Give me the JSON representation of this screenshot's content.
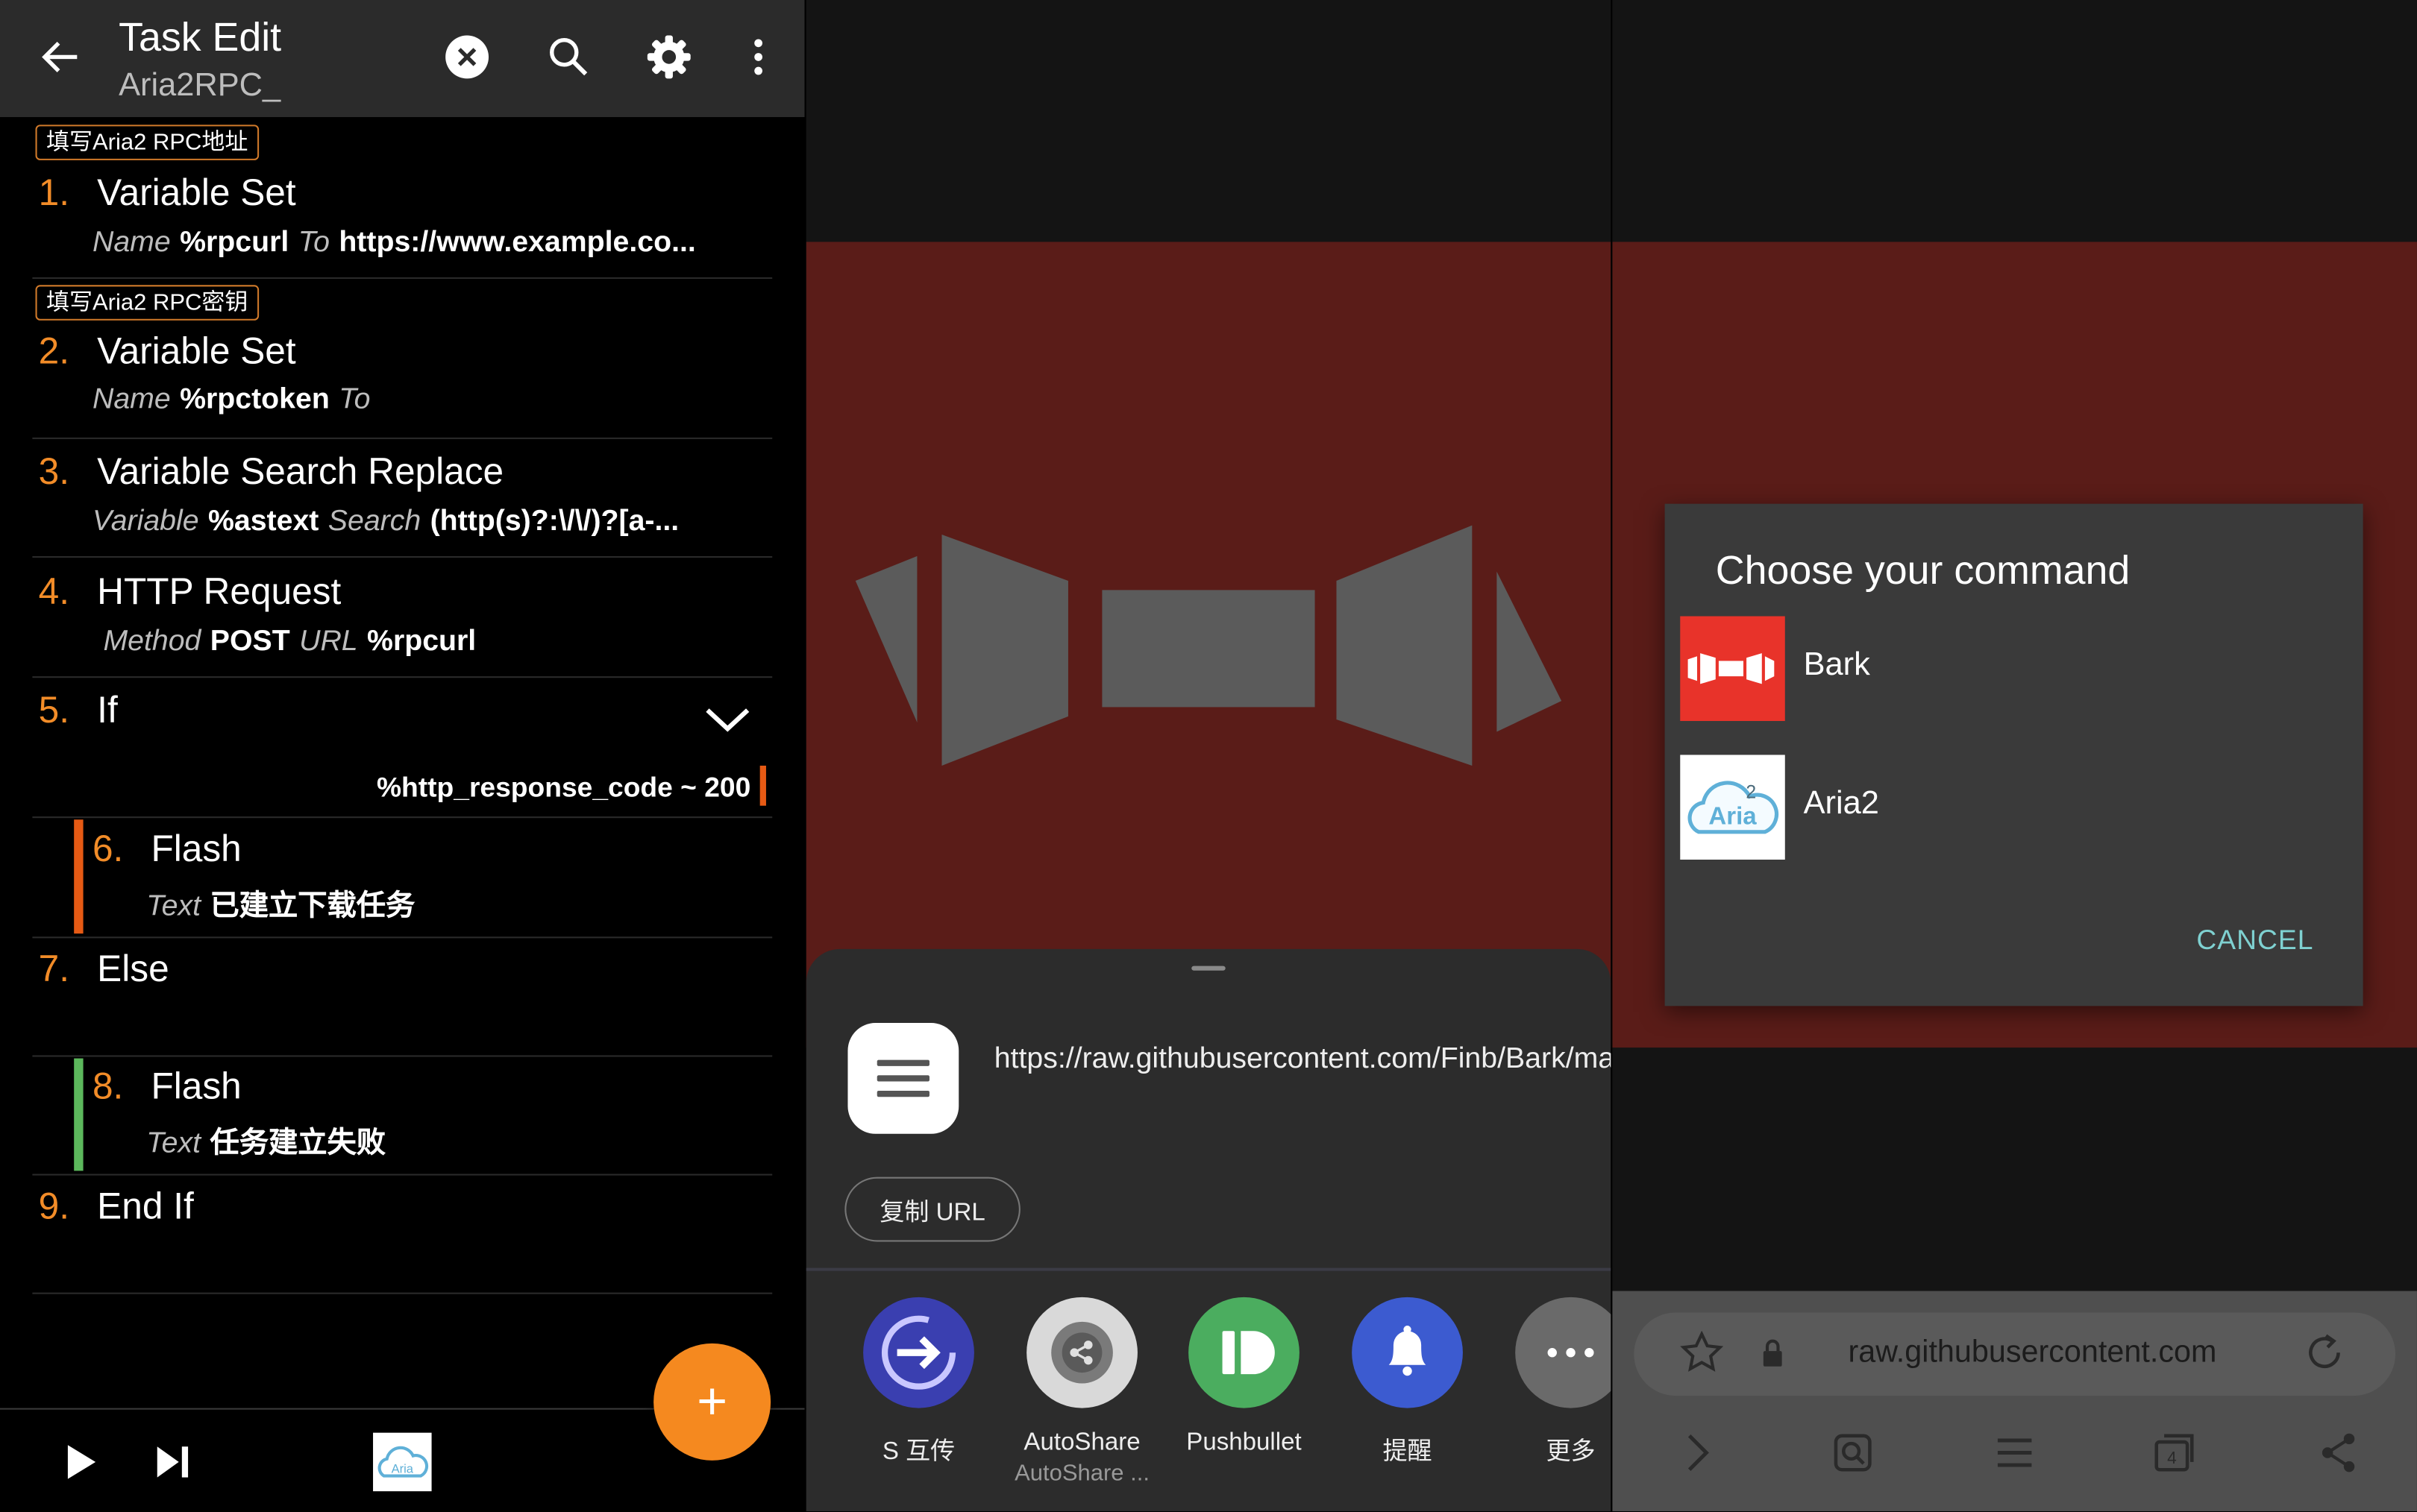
{
  "task_edit": {
    "title": "Task Edit",
    "subtitle": "Aria2RPC_",
    "icons": [
      "back-arrow-icon",
      "close-circle-icon",
      "search-icon",
      "gear-icon",
      "more-vertical-icon"
    ],
    "labels": {
      "label1": "填写Aria2 RPC地址",
      "label2": "填写Aria2 RPC密钥"
    },
    "actions": [
      {
        "num": "1.",
        "name": "Variable Set",
        "p1_key": "Name",
        "p1_val": "%rpcurl",
        "p2_key": "To",
        "p2_val": "https://www.example.co..."
      },
      {
        "num": "2.",
        "name": "Variable Set",
        "p1_key": "Name",
        "p1_val": "%rpctoken",
        "p2_key": "To",
        "p2_val": ""
      },
      {
        "num": "3.",
        "name": "Variable Search Replace",
        "p1_key": "Variable",
        "p1_val": "%astext",
        "p2_key": "Search",
        "p2_val": "(http(s)?:\\/\\/)?[a-..."
      },
      {
        "num": "4.",
        "name": "HTTP Request",
        "p1_key": "Method",
        "p1_val": "POST",
        "p2_key": "URL",
        "p2_val": "%rpcurl"
      },
      {
        "num": "5.",
        "name": "If",
        "condition": "%http_response_code ~ 200"
      },
      {
        "num": "6.",
        "name": "Flash",
        "p1_key": "Text",
        "p1_val": "已建立下载任务"
      },
      {
        "num": "7.",
        "name": "Else"
      },
      {
        "num": "8.",
        "name": "Flash",
        "p1_key": "Text",
        "p1_val": "任务建立失败"
      },
      {
        "num": "9.",
        "name": "End If"
      }
    ],
    "fab_label": "+",
    "bottom_icons": [
      "play-icon",
      "step-forward-icon",
      "aria2-task-icon"
    ]
  },
  "share_sheet": {
    "url": "https://raw.githubusercontent.com/Finb/Bark/master/Bark/Assets.xcassets/A...",
    "copy_label": "复制 URL",
    "apps": [
      {
        "label": "S 互传",
        "icon": "transfer-arrow-icon",
        "color": "#3a3fb0"
      },
      {
        "label": "AutoShare",
        "sublabel": "AutoShare ...",
        "icon": "autoshare-gear-icon",
        "color": "#d9d9d9"
      },
      {
        "label": "Pushbullet",
        "icon": "pushbullet-icon",
        "color": "#4bad5f"
      },
      {
        "label": "提醒",
        "icon": "bell-icon",
        "color": "#3c5bd0"
      },
      {
        "label": "更多",
        "icon": "more-dots-icon",
        "color": "#6a6a6a"
      }
    ]
  },
  "command_dialog": {
    "title": "Choose your command",
    "items": [
      {
        "label": "Bark",
        "icon": "bark-icon"
      },
      {
        "label": "Aria2",
        "icon": "aria2-cloud-icon"
      }
    ],
    "cancel_label": "CANCEL",
    "aria_badge": "Aria",
    "aria_num": "2"
  },
  "browser": {
    "address": "raw.githubusercontent.com",
    "tab_count": "4"
  }
}
